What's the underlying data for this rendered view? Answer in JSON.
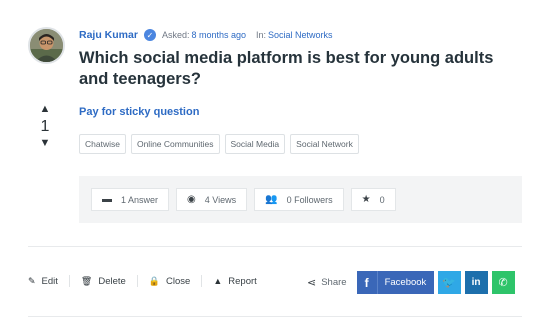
{
  "question": {
    "author": "Raju Kumar",
    "asked_label": "Asked:",
    "asked_value": "8 months ago",
    "in_label": "In:",
    "in_value": "Social Networks",
    "title": "Which social media platform is best for young adults and teenagers?",
    "sticky_link": "Pay for sticky question",
    "votes": "1",
    "tags": [
      "Chatwise",
      "Online Communities",
      "Social Media",
      "Social Network"
    ]
  },
  "stats": {
    "answers": "1 Answer",
    "views": "4 Views",
    "followers": "0 Followers",
    "favorites": "0"
  },
  "actions": {
    "edit": "Edit",
    "delete": "Delete",
    "close": "Close",
    "report": "Report"
  },
  "share": {
    "label": "Share",
    "facebook": "Facebook"
  },
  "icons": {
    "verified": "check-badge-icon",
    "upvote": "triangle-up-icon",
    "downvote": "triangle-down-icon",
    "answers": "comment-icon",
    "views": "eye-icon",
    "followers": "users-icon",
    "favorites": "star-icon",
    "edit": "pencil-icon",
    "delete": "trash-icon",
    "close": "lock-icon",
    "report": "warning-icon",
    "share": "share-icon",
    "facebook": "facebook-icon",
    "twitter": "twitter-icon",
    "linkedin": "linkedin-icon",
    "whatsapp": "whatsapp-icon"
  },
  "colors": {
    "link_blue": "#2e6bc4",
    "facebook": "#3a67b8",
    "twitter": "#2fa8e6",
    "linkedin": "#1d6fac",
    "whatsapp": "#2ec46a"
  }
}
